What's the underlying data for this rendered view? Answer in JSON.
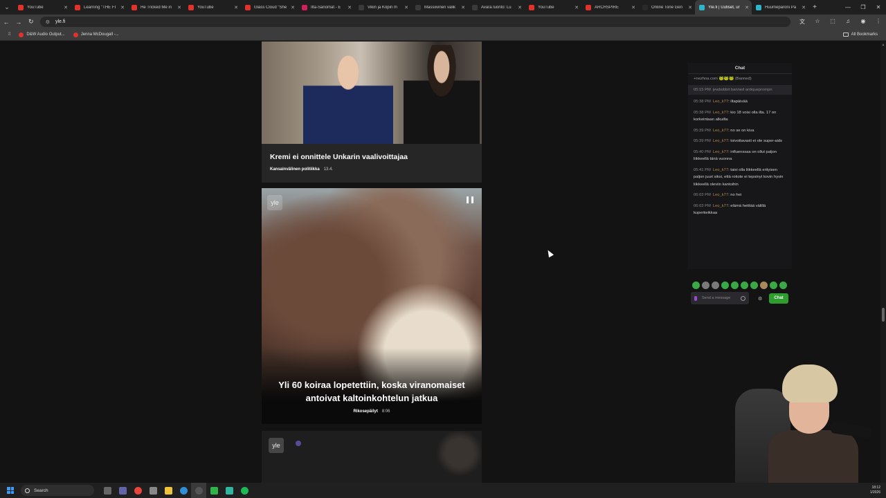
{
  "browser": {
    "tabs": [
      {
        "title": "YouTube",
        "favicon_color": "#e2322a",
        "active": false
      },
      {
        "title": "Learning \"THE FI",
        "favicon_color": "#e2322a",
        "active": false
      },
      {
        "title": "He Tricked Me in",
        "favicon_color": "#e2322a",
        "active": false
      },
      {
        "title": "YouTube",
        "favicon_color": "#e2322a",
        "active": false
      },
      {
        "title": "Glass Cloud \"She",
        "favicon_color": "#e2322a",
        "active": false
      },
      {
        "title": "Ilta-Sanomat - E",
        "favicon_color": "#d4205a",
        "active": false
      },
      {
        "title": "Vikin ja Köpin m",
        "favicon_color": "#3a3a3a",
        "active": false
      },
      {
        "title": "Massiivinen valik",
        "favicon_color": "#3a3a3a",
        "active": false
      },
      {
        "title": "Avara luonto: Lu",
        "favicon_color": "#3a3a3a",
        "active": false
      },
      {
        "title": "YouTube",
        "favicon_color": "#e2322a",
        "active": false
      },
      {
        "title": "ARCHSPIRE",
        "favicon_color": "#e2322a",
        "active": false
      },
      {
        "title": "Online Tone Gen",
        "favicon_color": "#2a2a2a",
        "active": false
      },
      {
        "title": "Yle.fi | Uutiset, ur",
        "favicon_color": "#2fb5c9",
        "active": true
      },
      {
        "title": "Huumeparoni Pa",
        "favicon_color": "#2fb5c9",
        "active": false
      }
    ],
    "address": "yle.fi",
    "bookmarks": [
      {
        "label": "D&W Audio Output..."
      },
      {
        "label": "Jenna McDougall -..."
      }
    ],
    "all_bookmarks_label": "All Bookmarks"
  },
  "articles": [
    {
      "title": "Kremi ei onnittele Unkarin vaalivoittajaa",
      "category": "Kansainvälinen politiikka",
      "date": "13.4."
    },
    {
      "title": "Yli 60 koiraa lopetettiin, koska viranomaiset antoivat kaltoinkohtelun jatkua",
      "category": "Rikosepäilyt",
      "duration": "8:06",
      "watermark": "yle"
    },
    {
      "watermark": "yle"
    }
  ],
  "chat": {
    "header": "Chat",
    "messages": [
      {
        "text": "+nezhna.com 🐸🐸🐸 (Banned)",
        "kind": "banned"
      },
      {
        "ts": "05:15 PM",
        "text": "jewbobbit banned antiqueprompn",
        "kind": "sys"
      },
      {
        "ts": "05:38 PM",
        "user": "Leo_k77",
        "text": "iltapäivää"
      },
      {
        "ts": "05:38 PM",
        "user": "Leo_k77",
        "text": "kio 18 voisi olla ilta. 17 on korkeintaan alkuilta"
      },
      {
        "ts": "05:39 PM",
        "user": "Leo_k77",
        "text": "no se on kiva"
      },
      {
        "ts": "05:39 PM",
        "user": "Leo_k77",
        "text": "toivottavasti ei ole super-aids"
      },
      {
        "ts": "05:40 PM",
        "user": "Leo_k77",
        "text": "influenssaa on ollut paljon liikkeellä tänä vuonna"
      },
      {
        "ts": "05:41 PM",
        "user": "Leo_k77",
        "text": "taisi olla liikkeellä erityisen paljon juuri siksi, että rokote ei tepsinyt kovin hyvin liikkeellä oleviin kantoihin"
      },
      {
        "ts": "06:03 PM",
        "user": "Leo_k77",
        "text": "no hei"
      },
      {
        "ts": "06:03 PM",
        "user": "Leo_k77",
        "text": "elämä heittää välillä kuperkeikkaa"
      }
    ],
    "input_placeholder": "Send a message",
    "send_label": "Chat"
  },
  "taskbar": {
    "search_label": "Search",
    "time": "18:12",
    "date": "1/2026"
  }
}
